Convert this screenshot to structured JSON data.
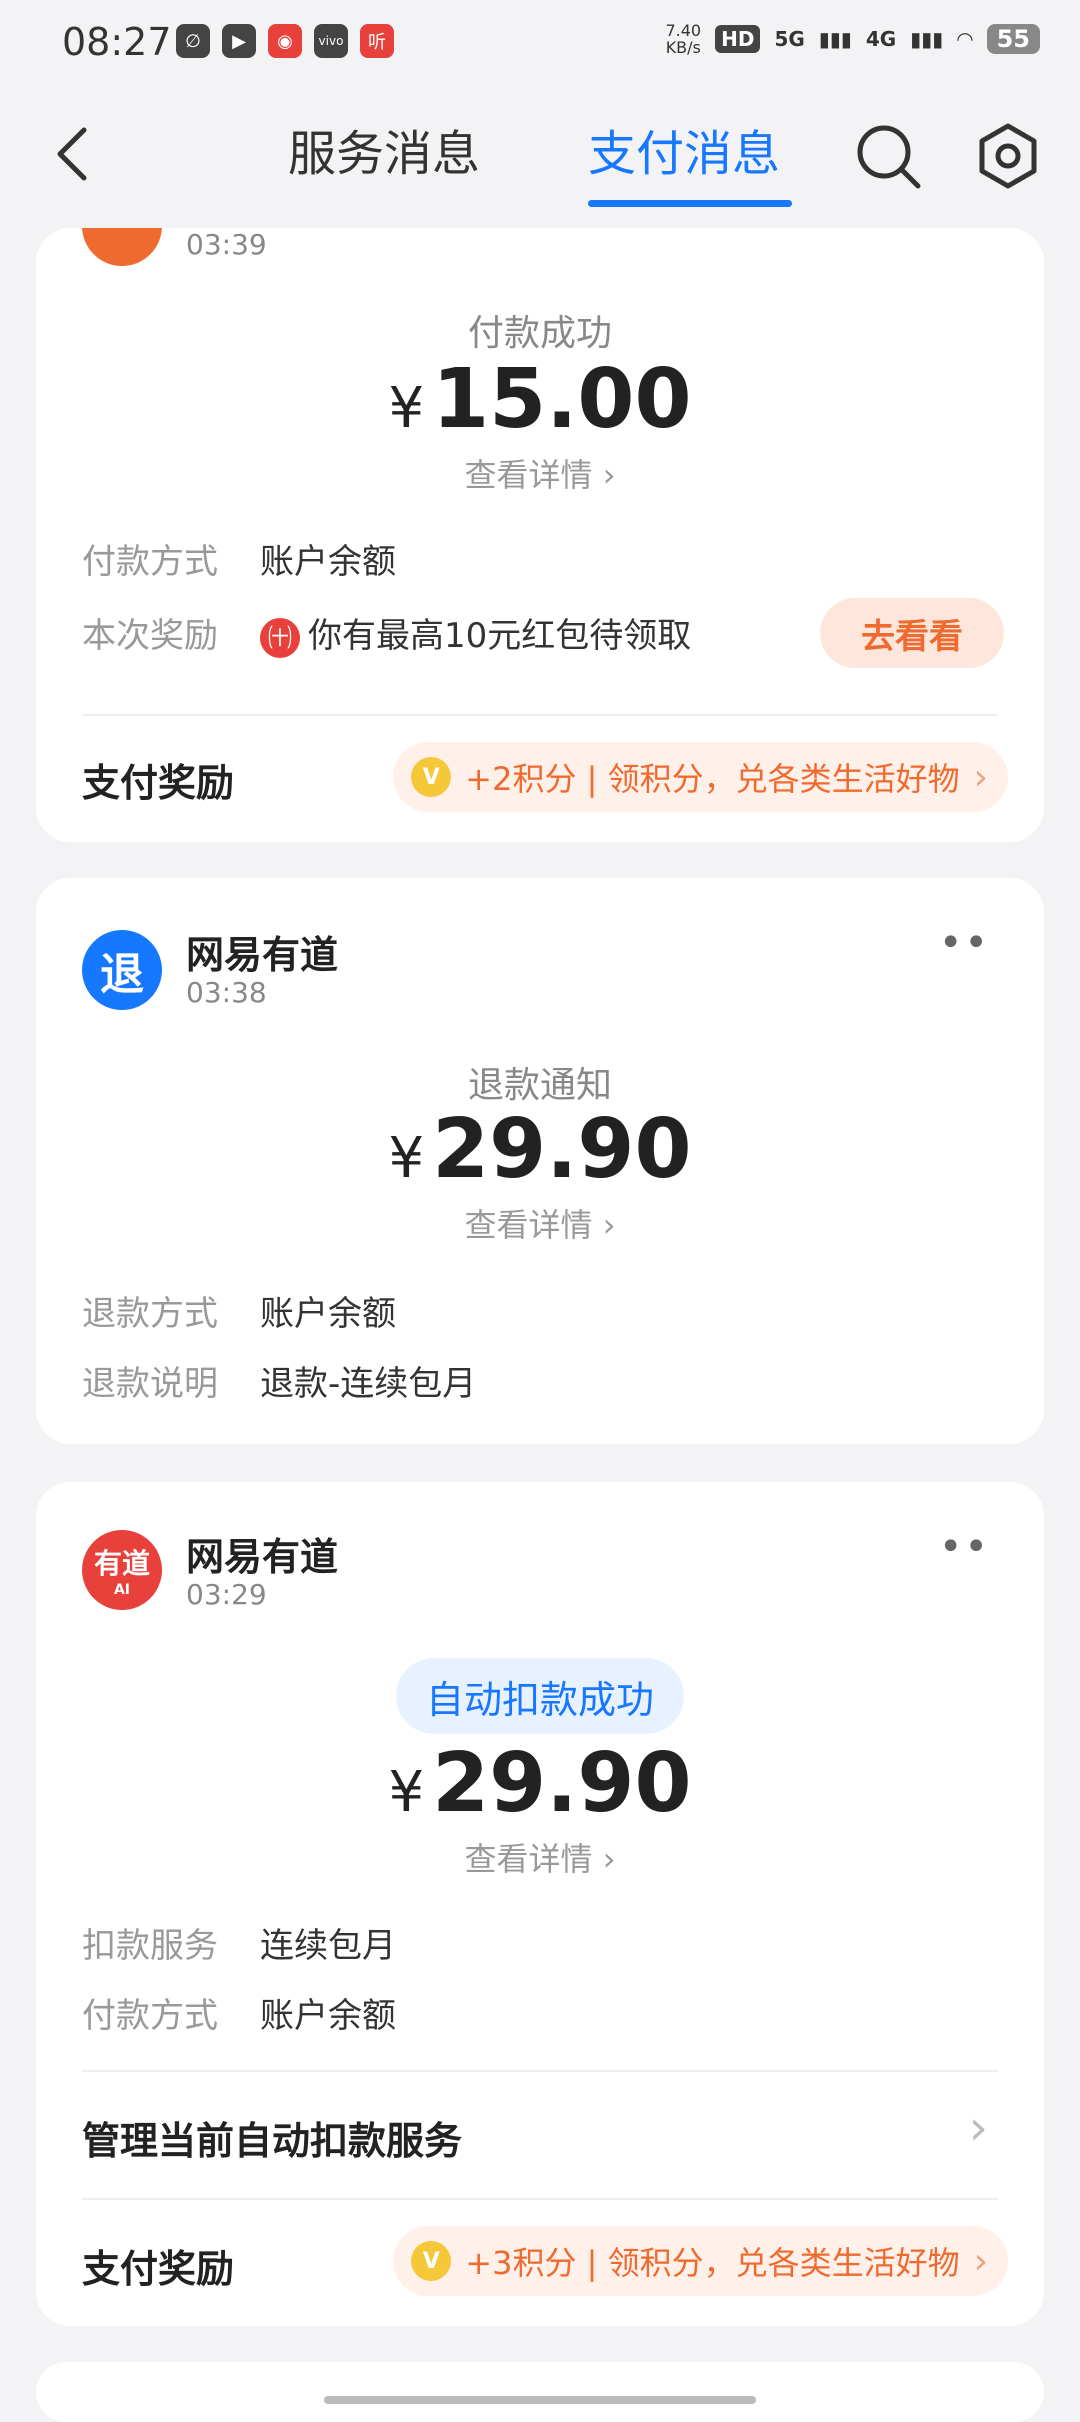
{
  "status_bar": {
    "time": "08:27",
    "net_speed_value": "7.40",
    "net_speed_unit": "KB/s",
    "hd_badge": "HD",
    "sim1": "5G",
    "sim2": "4G",
    "battery": "55",
    "app_icons": [
      "app-icon-1",
      "video-icon",
      "weibo-icon",
      "vivo-icon",
      "listen-icon"
    ],
    "listen_icon_text": "听",
    "vivo_icon_text": "vivo"
  },
  "nav": {
    "tab_service": "服务消息",
    "tab_payment": "支付消息",
    "active_tab": "支付消息",
    "accent_color": "#1677ff"
  },
  "cards": [
    {
      "time": "03:39",
      "status": "付款成功",
      "currency": "¥",
      "amount": "15.00",
      "detail_link": "查看详情",
      "rows": [
        {
          "label": "付款方式",
          "value": "账户余额"
        },
        {
          "label": "本次奖励",
          "value": "你有最高10元红包待领取"
        }
      ],
      "reward_badge_text": "㈩",
      "go_button": "去看看",
      "bottom_label": "支付奖励",
      "points_text": "+2积分 | 领积分，兑各类生活好物"
    },
    {
      "app_name": "网易有道",
      "time": "03:38",
      "icon_text": "退",
      "icon_color": "#1677ff",
      "status": "退款通知",
      "currency": "¥",
      "amount": "29.90",
      "detail_link": "查看详情",
      "rows": [
        {
          "label": "退款方式",
          "value": "账户余额"
        },
        {
          "label": "退款说明",
          "value": "退款-连续包月"
        }
      ]
    },
    {
      "app_name": "网易有道",
      "time": "03:29",
      "icon_text": "有道",
      "icon_sub": "AI",
      "icon_color": "#e8403a",
      "status": "自动扣款成功",
      "currency": "¥",
      "amount": "29.90",
      "detail_link": "查看详情",
      "rows": [
        {
          "label": "扣款服务",
          "value": "连续包月"
        },
        {
          "label": "付款方式",
          "value": "账户余额"
        }
      ],
      "manage_label": "管理当前自动扣款服务",
      "bottom_label": "支付奖励",
      "points_text": "+3积分 | 领积分，兑各类生活好物"
    }
  ],
  "more_glyph": "••",
  "chevron_glyph": "›",
  "coin_glyph": "V"
}
